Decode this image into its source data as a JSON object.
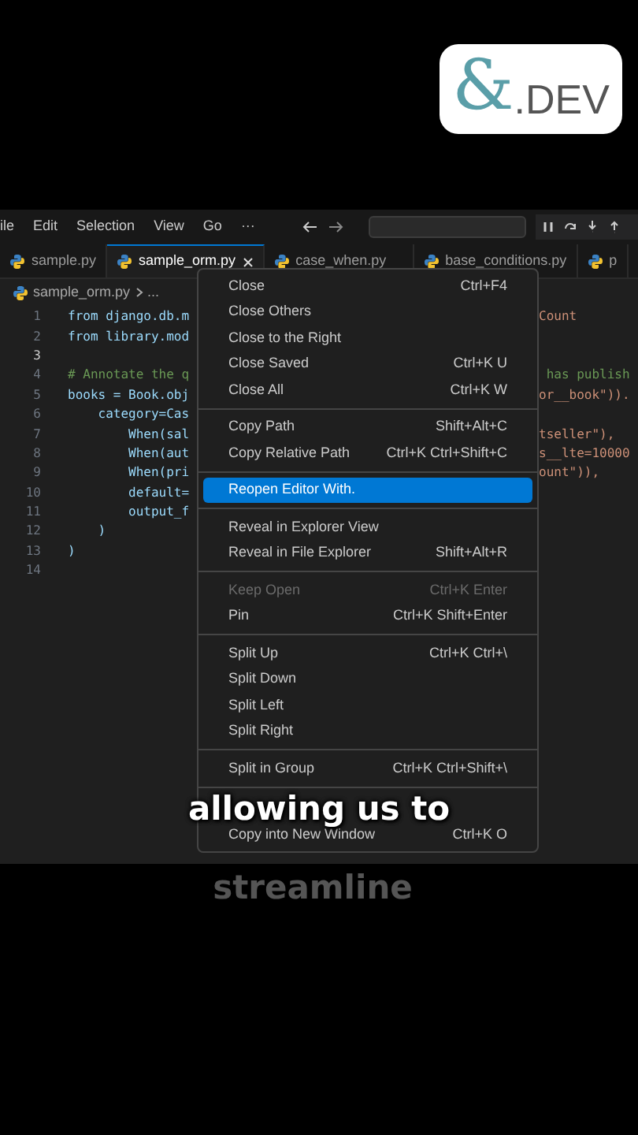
{
  "logo": {
    "symbol": "&",
    "text": ".DEV"
  },
  "menu_bar": [
    "ile",
    "Edit",
    "Selection",
    "View",
    "Go",
    "···"
  ],
  "tabs": [
    {
      "label": "sample.py",
      "selected": false,
      "closable": false
    },
    {
      "label": "sample_orm.py",
      "selected": true,
      "closable": true
    },
    {
      "label": "case_when.py",
      "selected": false,
      "closable": false
    },
    {
      "label": "base_conditions.py",
      "selected": false,
      "closable": false
    },
    {
      "label": "p",
      "selected": false,
      "closable": false
    }
  ],
  "breadcrumb": [
    "sample_orm.py",
    "..."
  ],
  "code_lines": [
    {
      "number": "1",
      "left": "from django.db.m",
      "right": "Count",
      "kind": "code",
      "selected": false
    },
    {
      "number": "2",
      "left": "from library.mod",
      "kind": "code",
      "selected": false
    },
    {
      "number": "3",
      "selected": true
    },
    {
      "number": "4",
      "left": "# Annotate the q",
      "right": " has publish",
      "kind": "comment",
      "selected": false
    },
    {
      "number": "5",
      "left": "books = Book.obj",
      "right": "or__book\")).",
      "kind": "code",
      "selected": false
    },
    {
      "number": "6",
      "left": "    category=Cas",
      "kind": "code",
      "selected": false
    },
    {
      "number": "7",
      "left": "        When(sal",
      "right": "tseller\"),",
      "kind": "code",
      "selected": false
    },
    {
      "number": "8",
      "left": "        When(aut",
      "right": "s__lte=10000",
      "kind": "code",
      "selected": false
    },
    {
      "number": "9",
      "left": "        When(pri",
      "right": "ount\")),",
      "kind": "code",
      "selected": false
    },
    {
      "number": "10",
      "left": "        default=",
      "kind": "code",
      "selected": false
    },
    {
      "number": "11",
      "left": "        output_f",
      "kind": "code",
      "selected": false
    },
    {
      "number": "12",
      "left": "    )",
      "kind": "code",
      "selected": false
    },
    {
      "number": "13",
      "left": ")",
      "kind": "code",
      "selected": false
    },
    {
      "number": "14",
      "selected": false
    }
  ],
  "context_menu": [
    [
      {
        "label": "Close",
        "shortcut": "Ctrl+F4",
        "disabled": false,
        "selected": false
      },
      {
        "label": "Close Others",
        "disabled": false,
        "selected": false
      },
      {
        "label": "Close to the Right",
        "disabled": false,
        "selected": false
      },
      {
        "label": "Close Saved",
        "shortcut": "Ctrl+K U",
        "disabled": false,
        "selected": false
      },
      {
        "label": "Close All",
        "shortcut": "Ctrl+K W",
        "disabled": false,
        "selected": false
      }
    ],
    [
      {
        "label": "Copy Path",
        "shortcut": "Shift+Alt+C",
        "disabled": false,
        "selected": false
      },
      {
        "label": "Copy Relative Path",
        "shortcut": "Ctrl+K Ctrl+Shift+C",
        "disabled": false,
        "selected": false
      }
    ],
    [
      {
        "label": "Reopen Editor With.",
        "disabled": false,
        "selected": true
      }
    ],
    [
      {
        "label": "Reveal in Explorer View",
        "disabled": false,
        "selected": false
      },
      {
        "label": "Reveal in File Explorer",
        "shortcut": "Shift+Alt+R",
        "disabled": false,
        "selected": false
      }
    ],
    [
      {
        "label": "Keep Open",
        "shortcut": "Ctrl+K Enter",
        "disabled": true,
        "selected": false
      },
      {
        "label": "Pin",
        "shortcut": "Ctrl+K Shift+Enter",
        "disabled": false,
        "selected": false
      }
    ],
    [
      {
        "label": "Split Up",
        "shortcut": "Ctrl+K Ctrl+\\",
        "disabled": false,
        "selected": false
      },
      {
        "label": "Split Down",
        "disabled": false,
        "selected": false
      },
      {
        "label": "Split Left",
        "disabled": false,
        "selected": false
      },
      {
        "label": "Split Right",
        "disabled": false,
        "selected": false
      }
    ],
    [
      {
        "label": "Split in Group",
        "shortcut": "Ctrl+K Ctrl+Shift+\\",
        "disabled": false,
        "selected": false
      }
    ],
    [
      {
        "label": "Copy into New Window",
        "shortcut": "Ctrl+K O",
        "disabled": false,
        "selected": false
      }
    ]
  ],
  "captions": [
    {
      "text": "allowing us to",
      "kind": "current"
    },
    {
      "text": "streamline",
      "kind": "upcoming"
    }
  ]
}
